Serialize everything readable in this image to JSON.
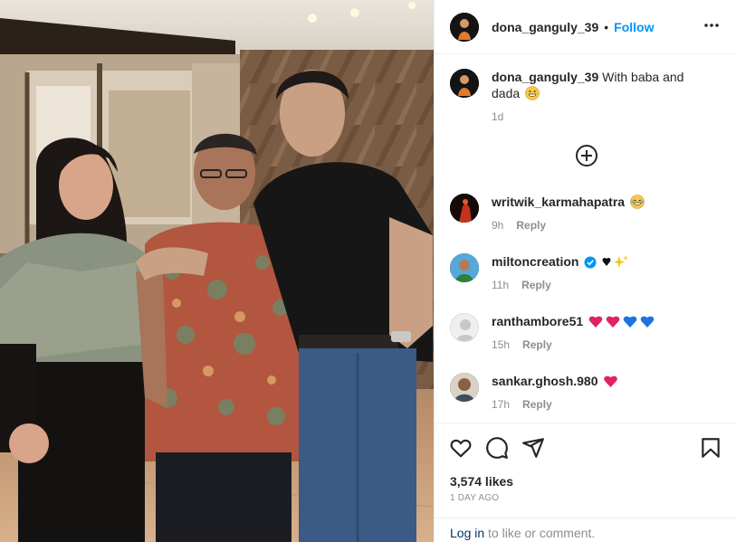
{
  "post": {
    "author": "dona_ganguly_39",
    "follow_label": "Follow",
    "separator": "•",
    "caption": {
      "username": "dona_ganguly_39",
      "text": "With baba and dada",
      "emoji": "grinning-face",
      "age": "1d"
    }
  },
  "comments": [
    {
      "username": "writwik_karmahapatra",
      "emoji": "laughing-tears",
      "age": "9h",
      "reply_label": "Reply"
    },
    {
      "username": "miltoncreation",
      "verified": true,
      "emoji": "black-heart-sparkles",
      "age": "11h",
      "reply_label": "Reply"
    },
    {
      "username": "ranthambore51",
      "emoji": "hearts-red-blue",
      "age": "15h",
      "reply_label": "Reply"
    },
    {
      "username": "sankar.ghosh.980",
      "emoji": "red-heart",
      "age": "17h",
      "reply_label": "Reply"
    }
  ],
  "footer": {
    "likes": "3,574 likes",
    "date": "1 DAY AGO",
    "login_link": "Log in",
    "login_rest": " to like or comment."
  },
  "colors": {
    "accent": "#0095f6",
    "text": "#262626",
    "muted": "#8e8e8e",
    "link": "#00376b",
    "divider": "#efefef"
  },
  "icons": [
    "more-options-icon",
    "load-more-comments-icon",
    "like-heart-icon",
    "comment-icon",
    "share-icon",
    "save-bookmark-icon",
    "verified-badge-icon"
  ]
}
